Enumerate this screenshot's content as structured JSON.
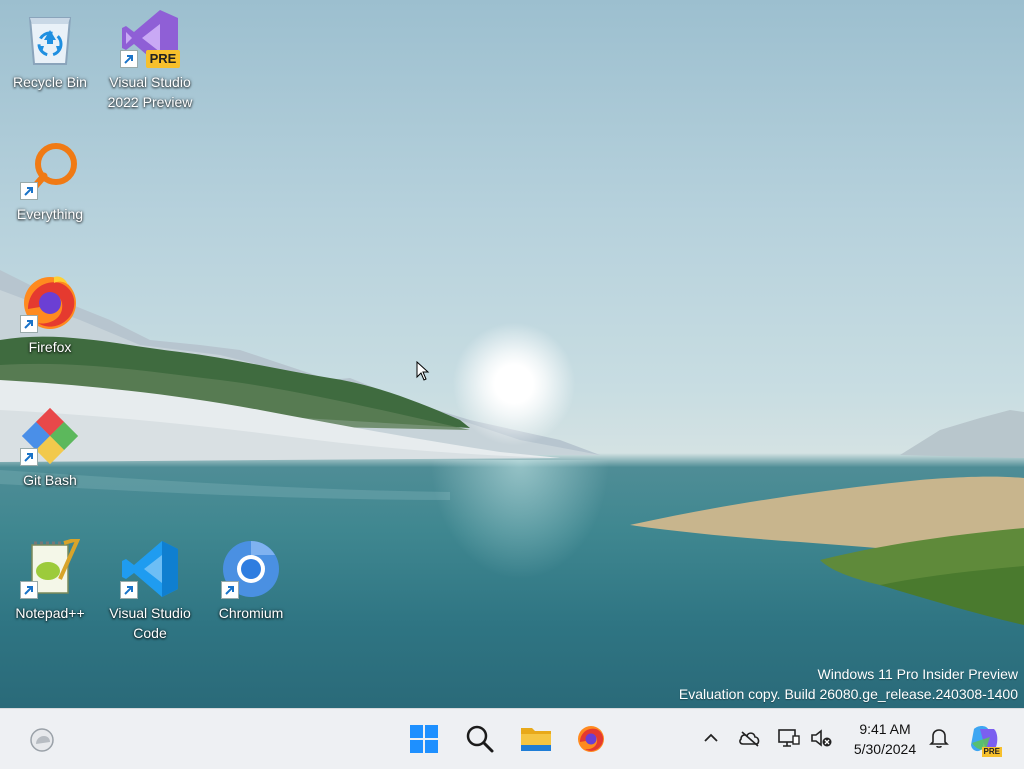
{
  "desktop": {
    "icons": [
      {
        "label": "Recycle Bin",
        "icon": "recycle-bin-icon"
      },
      {
        "label": "Visual Studio 2022 Preview",
        "line1": "Visual Studio",
        "line2": "2022 Preview",
        "icon": "visual-studio-preview-icon",
        "badge": "PRE"
      },
      {
        "label": "Everything",
        "icon": "everything-search-icon"
      },
      {
        "label": "Firefox",
        "icon": "firefox-icon"
      },
      {
        "label": "Git Bash",
        "icon": "git-bash-icon"
      },
      {
        "label": "Notepad++",
        "icon": "notepad-plus-plus-icon"
      },
      {
        "label": "Visual Studio Code",
        "line1": "Visual Studio",
        "line2": "Code",
        "icon": "vscode-icon"
      },
      {
        "label": "Chromium",
        "icon": "chromium-icon"
      }
    ]
  },
  "watermark": {
    "line1": "Windows 11 Pro Insider Preview",
    "line2": "Evaluation copy. Build 26080.ge_release.240308-1400"
  },
  "taskbar": {
    "pinned": [
      "start-icon",
      "search-icon",
      "file-explorer-icon",
      "firefox-icon"
    ],
    "tray": [
      "chevron-up-icon",
      "onedrive-icon",
      "display-icon",
      "volume-muted-icon"
    ],
    "clock": {
      "time": "9:41 AM",
      "date": "5/30/2024"
    },
    "copilot_badge": "PRE"
  },
  "colors": {
    "taskbar_bg": "#eef0f3",
    "vs_purple": "#7e57c2",
    "vscode_blue": "#1f9cf0",
    "explorer_yellow": "#f5c542",
    "everything_orange": "#f07a14"
  }
}
